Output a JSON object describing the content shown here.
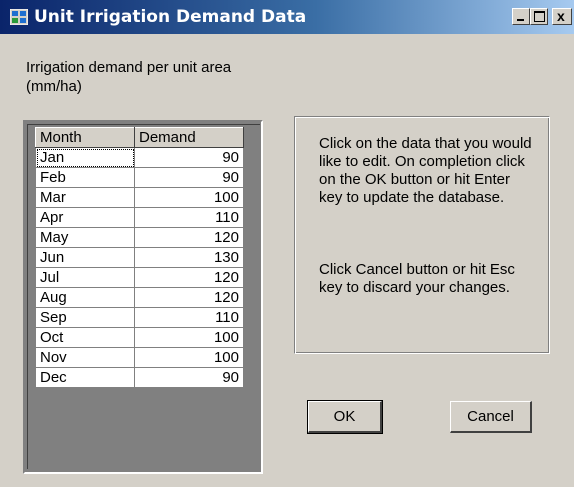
{
  "window": {
    "title": "Unit Irrigation Demand Data",
    "icon": "grid-app-icon",
    "controls": [
      "minimize-icon",
      "maximize-icon",
      "close-icon"
    ],
    "close_glyph": "x"
  },
  "label": {
    "line1": "Irrigation demand per unit area",
    "line2": "(mm/ha)"
  },
  "grid": {
    "columns": [
      "Month",
      "Demand"
    ],
    "rows": [
      {
        "month": "Jan",
        "demand": "90"
      },
      {
        "month": "Feb",
        "demand": "90"
      },
      {
        "month": "Mar",
        "demand": "100"
      },
      {
        "month": "Apr",
        "demand": "110"
      },
      {
        "month": "May",
        "demand": "120"
      },
      {
        "month": "Jun",
        "demand": "130"
      },
      {
        "month": "Jul",
        "demand": "120"
      },
      {
        "month": "Aug",
        "demand": "120"
      },
      {
        "month": "Sep",
        "demand": "110"
      },
      {
        "month": "Oct",
        "demand": "100"
      },
      {
        "month": "Nov",
        "demand": "100"
      },
      {
        "month": "Dec",
        "demand": "90"
      }
    ]
  },
  "info": {
    "paragraph1": "Click on the data that you would like to edit. On completion click on the OK button or hit Enter key to update the database.",
    "paragraph2": "Click Cancel button or hit Esc key to discard your changes."
  },
  "buttons": {
    "ok": "OK",
    "cancel": "Cancel"
  },
  "colors": {
    "title_start": "#0a246a",
    "title_end": "#a6caf0",
    "face": "#d4d0c8"
  }
}
